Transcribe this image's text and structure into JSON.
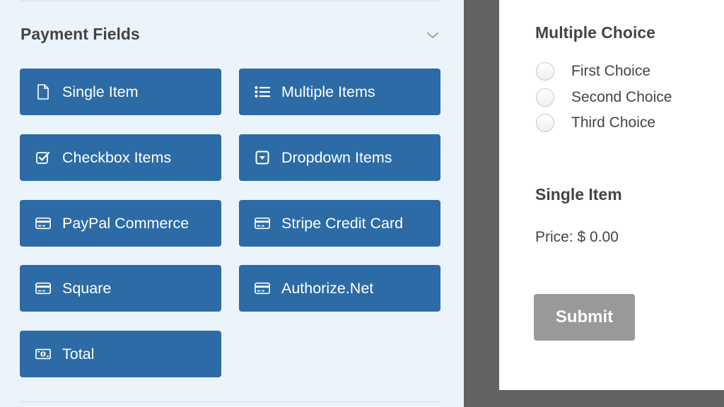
{
  "payment_fields": {
    "title": "Payment Fields",
    "toggle_icon": "chevron-down-icon",
    "buttons": [
      {
        "label": "Single Item",
        "icon": "file-icon"
      },
      {
        "label": "Multiple Items",
        "icon": "list-icon"
      },
      {
        "label": "Checkbox Items",
        "icon": "checkbox-icon"
      },
      {
        "label": "Dropdown Items",
        "icon": "dropdown-icon"
      },
      {
        "label": "PayPal Commerce",
        "icon": "credit-card-icon"
      },
      {
        "label": "Stripe Credit Card",
        "icon": "credit-card-icon"
      },
      {
        "label": "Square",
        "icon": "credit-card-icon"
      },
      {
        "label": "Authorize.Net",
        "icon": "credit-card-icon"
      },
      {
        "label": "Total",
        "icon": "money-bill-icon"
      }
    ]
  },
  "preview": {
    "multiple_choice": {
      "title": "Multiple Choice",
      "choices": [
        "First Choice",
        "Second Choice",
        "Third Choice"
      ]
    },
    "single_item": {
      "title": "Single Item",
      "price": "Price: $ 0.00"
    },
    "submit_label": "Submit"
  },
  "colors": {
    "button_bg": "#2d6ba6",
    "panel_bg": "#ebf3fb",
    "backdrop": "#636363",
    "submit_bg": "#999999"
  }
}
